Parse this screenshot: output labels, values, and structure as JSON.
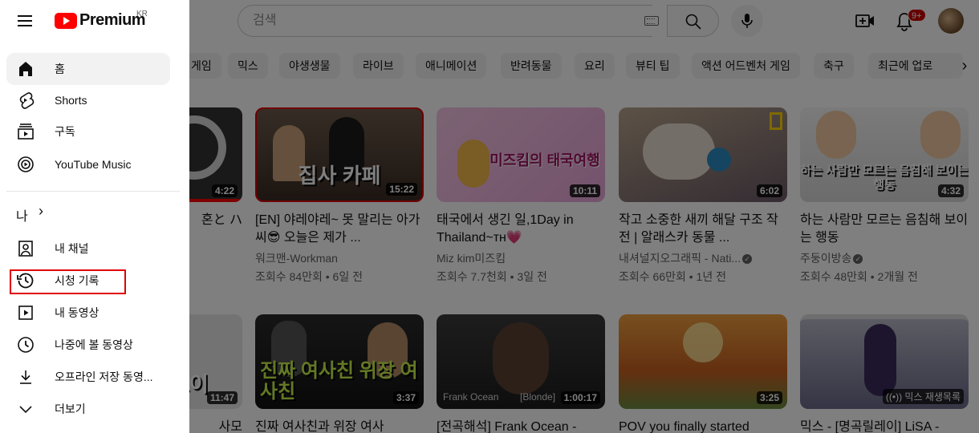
{
  "header": {
    "search_placeholder": "검색",
    "notification_count": "9+"
  },
  "drawer": {
    "logo_text": "Premium",
    "logo_region": "KR",
    "main_items": [
      {
        "label": "홈",
        "icon": "home-icon",
        "active": true
      },
      {
        "label": "Shorts",
        "icon": "shorts-icon"
      },
      {
        "label": "구독",
        "icon": "subscriptions-icon"
      },
      {
        "label": "YouTube Music",
        "icon": "youtube-music-icon"
      }
    ],
    "me_label": "나",
    "me_chevron": "›",
    "me_items": [
      {
        "label": "내 채널",
        "icon": "channel-icon"
      },
      {
        "label": "시청 기록",
        "icon": "history-icon",
        "highlighted": true
      },
      {
        "label": "내 동영상",
        "icon": "your-videos-icon"
      },
      {
        "label": "나중에 볼 동영상",
        "icon": "watch-later-icon"
      },
      {
        "label": "오프라인 저장 동영...",
        "icon": "download-icon"
      },
      {
        "label": "더보기",
        "icon": "chevron-down-icon"
      }
    ]
  },
  "chips": [
    "게임",
    "믹스",
    "야생생물",
    "라이브",
    "애니메이션",
    "반려동물",
    "요리",
    "뷰티 팁",
    "액션 어드벤처 게임",
    "축구",
    "최근에 업로"
  ],
  "videos_row1": [
    {
      "title": "",
      "channel": "",
      "meta": "",
      "duration": "4:22",
      "partial_text": "혼と ハ"
    },
    {
      "title": "[EN] 야레야레~ 못 말리는 아가씨😎 오늘은 제가 ...",
      "channel": "워크맨-Workman",
      "meta": "조회수 84만회 • 6일 전",
      "duration": "15:22",
      "thumb_text": "집사 카페"
    },
    {
      "title": "태국에서 생긴 일,1Day in Thailand~ᴛʜ💗",
      "channel": "Miz kim미즈킴",
      "meta": "조회수 7.7천회 • 3일 전",
      "duration": "10:11",
      "thumb_text": "미즈킴의 태국여행"
    },
    {
      "title": "작고 소중한 새끼 해달 구조 작전 | 알래스카 동물 ...",
      "channel": "내셔널지오그래픽 - Nati...",
      "meta": "조회수 66만회 • 1년 전",
      "duration": "6:02",
      "verified": true
    },
    {
      "title": "하는 사람만 모르는 음침해 보이는 행동",
      "channel": "주둥이방송",
      "meta": "조회수 48만회 • 2개월 전",
      "duration": "4:32",
      "verified": true,
      "thumb_text": "하는 사람만 모르는 음침해 보이는 행동"
    }
  ],
  "videos_row2": [
    {
      "title": "사모",
      "duration": "11:47",
      "partial_text": "초이"
    },
    {
      "title": "진짜 여사친과 위장 여사",
      "duration": "3:37",
      "thumb_text": "진짜 여사친 위장 여사친"
    },
    {
      "title": "[전곡해석] Frank Ocean -",
      "duration": "1:00:17",
      "thumb_left": "Frank Ocean",
      "thumb_right": "[Blonde]"
    },
    {
      "title": "POV you finally started",
      "duration": "3:25"
    },
    {
      "title": "믹스 - [명곡릴레이] LiSA -",
      "badge": "믹스 재생목록"
    }
  ]
}
